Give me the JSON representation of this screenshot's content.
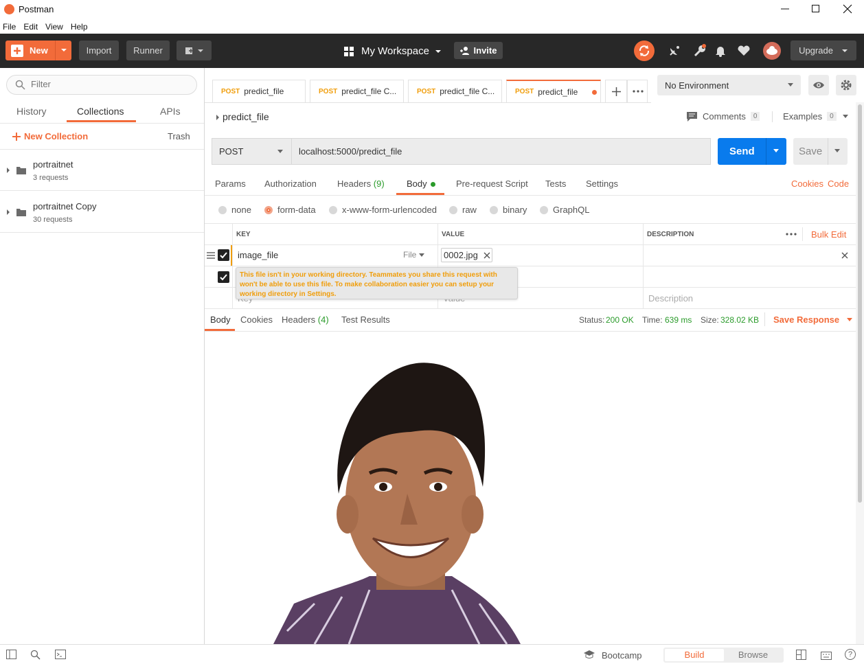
{
  "window": {
    "title": "Postman"
  },
  "menu": [
    "File",
    "Edit",
    "View",
    "Help"
  ],
  "header": {
    "new_label": "New",
    "import_label": "Import",
    "runner_label": "Runner",
    "workspace_label": "My Workspace",
    "invite_label": "Invite",
    "upgrade_label": "Upgrade"
  },
  "sidebar": {
    "filter_placeholder": "Filter",
    "tabs": [
      "History",
      "Collections",
      "APIs"
    ],
    "new_collection_label": "New Collection",
    "trash_label": "Trash",
    "collections": [
      {
        "name": "portraitnet",
        "count": "3 requests"
      },
      {
        "name": "portraitnet Copy",
        "count": "30 requests"
      }
    ]
  },
  "tabs": [
    {
      "method": "POST",
      "name": "predict_file"
    },
    {
      "method": "POST",
      "name": "predict_file C..."
    },
    {
      "method": "POST",
      "name": "predict_file C..."
    },
    {
      "method": "POST",
      "name": "predict_file"
    }
  ],
  "environment": {
    "selected": "No Environment"
  },
  "request": {
    "name": "predict_file",
    "comments_label": "Comments",
    "comments_count": "0",
    "examples_label": "Examples",
    "examples_count": "0",
    "method": "POST",
    "url": "localhost:5000/predict_file",
    "send_label": "Send",
    "save_label": "Save",
    "subtabs": [
      "Params",
      "Authorization",
      "Headers",
      "Body",
      "Pre-request Script",
      "Tests",
      "Settings"
    ],
    "headers_count": "(9)",
    "cookies_label": "Cookies",
    "code_label": "Code",
    "body_types": [
      "none",
      "form-data",
      "x-www-form-urlencoded",
      "raw",
      "binary",
      "GraphQL"
    ],
    "table_headers": {
      "key": "KEY",
      "value": "VALUE",
      "description": "DESCRIPTION",
      "bulk_edit": "Bulk Edit"
    },
    "rows": [
      {
        "key": "image_file",
        "type": "File",
        "value": "0002.jpg"
      }
    ],
    "placeholder_key": "Key",
    "placeholder_value": "Value",
    "placeholder_description": "Description",
    "tooltip": "This file isn't in your working directory. Teammates you share this request with won't be able to use this file. To make collaboration easier you can setup your working directory in Settings."
  },
  "response": {
    "tabs": [
      "Body",
      "Cookies",
      "Headers",
      "Test Results"
    ],
    "headers_count": "(4)",
    "status_label": "Status:",
    "status_value": "200 OK",
    "time_label": "Time:",
    "time_value": "639 ms",
    "size_label": "Size:",
    "size_value": "328.02 KB",
    "save_response_label": "Save Response"
  },
  "statusbar": {
    "bootcamp_label": "Bootcamp",
    "build_label": "Build",
    "browse_label": "Browse"
  },
  "colors": {
    "accent": "#f26b3a",
    "header_bg": "#282828",
    "send_blue": "#097bed",
    "status_green": "#2a9b2a"
  }
}
